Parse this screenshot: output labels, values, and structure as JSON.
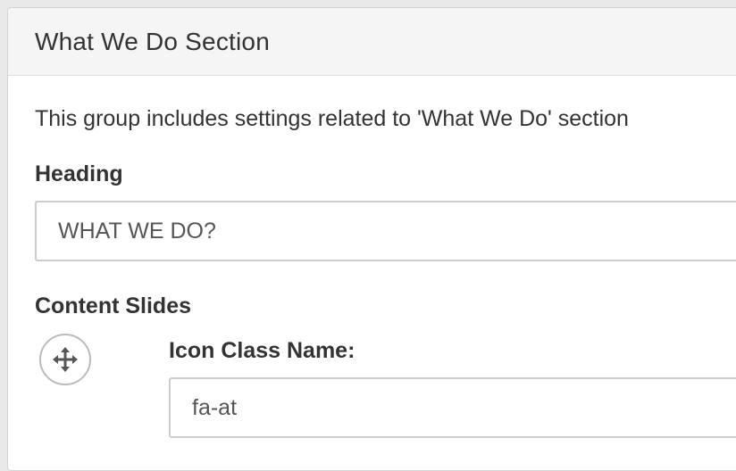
{
  "panel": {
    "title": "What We Do Section",
    "description": "This group includes settings related to 'What We Do' section"
  },
  "heading_field": {
    "label": "Heading",
    "value": "WHAT WE DO?"
  },
  "content_slides": {
    "label": "Content Slides",
    "move_icon": "arrows-move-icon",
    "icon_class_field": {
      "label": "Icon Class Name:",
      "value": "fa-at"
    }
  },
  "colors": {
    "panel_header_bg": "#f5f5f5",
    "border": "#cccccc",
    "text": "#333333"
  }
}
